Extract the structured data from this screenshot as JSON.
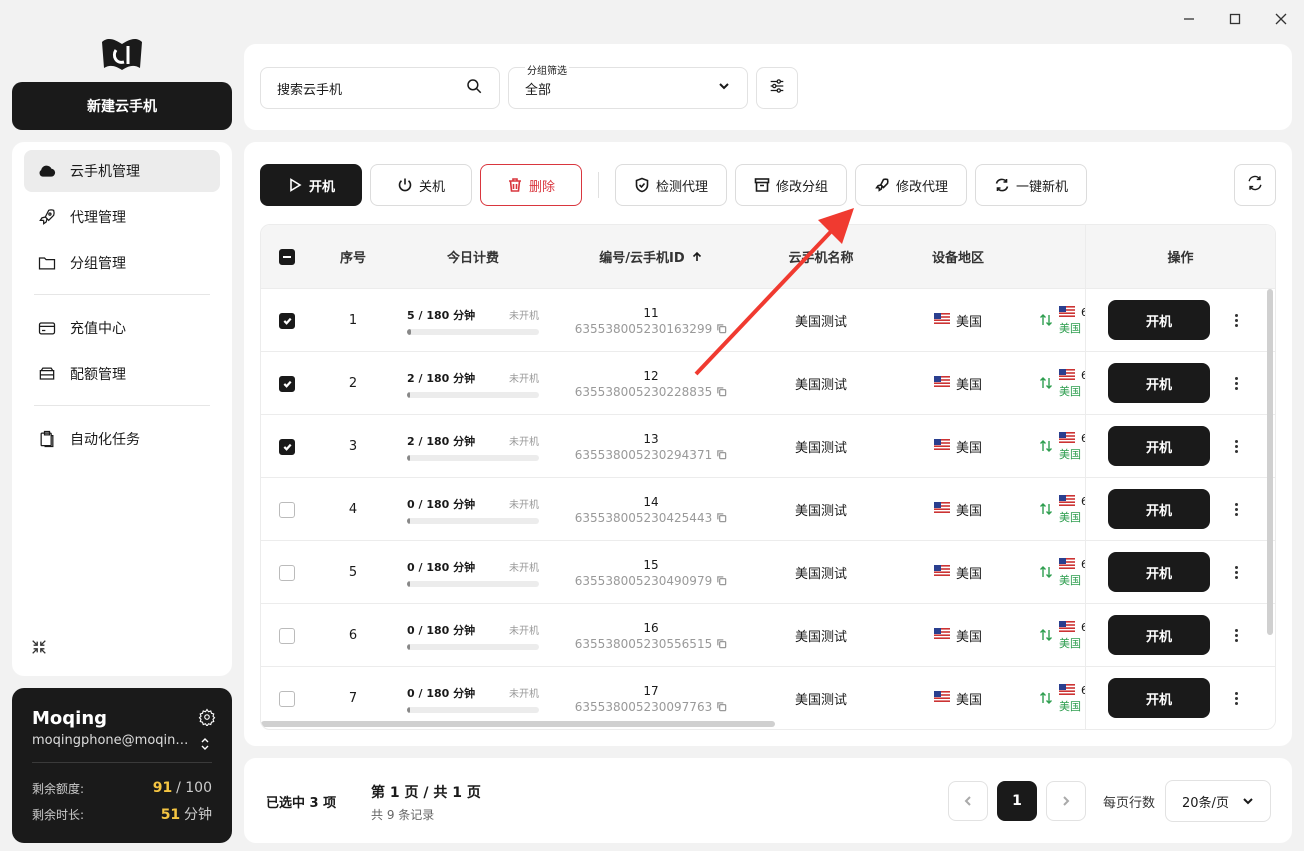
{
  "window": {
    "controls": [
      "minimize-icon",
      "maximize-icon",
      "close-icon"
    ]
  },
  "sidebar": {
    "logo": "app-logo",
    "new_button": "新建云手机",
    "items": [
      {
        "label": "云手机管理",
        "icon": "cloud-icon",
        "active": true
      },
      {
        "label": "代理管理",
        "icon": "rocket-icon"
      },
      {
        "label": "分组管理",
        "icon": "folder-icon"
      },
      {
        "label": "充值中心",
        "icon": "card-icon"
      },
      {
        "label": "配额管理",
        "icon": "storage-icon"
      },
      {
        "label": "自动化任务",
        "icon": "clipboard-icon"
      }
    ],
    "user": {
      "name": "Moqing",
      "email": "moqingphone@moqing....",
      "quota_label": "剩余额度:",
      "quota_value": "91",
      "quota_total": "/ 100",
      "time_label": "剩余时长:",
      "time_value": "51",
      "time_unit": "分钟"
    }
  },
  "search": {
    "placeholder": "搜索云手机",
    "group_label": "分组筛选",
    "group_value": "全部"
  },
  "toolbar": {
    "power_on": "开机",
    "power_off": "关机",
    "delete": "删除",
    "check_proxy": "检测代理",
    "edit_group": "修改分组",
    "edit_proxy": "修改代理",
    "one_click_new": "一键新机"
  },
  "table": {
    "headers": {
      "index": "序号",
      "fee": "今日计费",
      "id": "编号/云手机ID",
      "name": "云手机名称",
      "region": "设备地区",
      "proxy": "",
      "actions": "操作"
    },
    "rows": [
      {
        "checked": true,
        "index": "1",
        "fee": "5 / 180 分钟",
        "status": "未开机",
        "progress": 0.028,
        "num": "11",
        "cid": "635538005230163299",
        "name": "美国测试",
        "region": "美国",
        "proxy_top": "6",
        "proxy_bottom": "美国",
        "action": "开机"
      },
      {
        "checked": true,
        "index": "2",
        "fee": "2 / 180 分钟",
        "status": "未开机",
        "progress": 0.011,
        "num": "12",
        "cid": "635538005230228835",
        "name": "美国测试",
        "region": "美国",
        "proxy_top": "6",
        "proxy_bottom": "美国",
        "action": "开机"
      },
      {
        "checked": true,
        "index": "3",
        "fee": "2 / 180 分钟",
        "status": "未开机",
        "progress": 0.011,
        "num": "13",
        "cid": "635538005230294371",
        "name": "美国测试",
        "region": "美国",
        "proxy_top": "6",
        "proxy_bottom": "美国",
        "action": "开机"
      },
      {
        "checked": false,
        "index": "4",
        "fee": "0 / 180 分钟",
        "status": "未开机",
        "progress": 0,
        "num": "14",
        "cid": "635538005230425443",
        "name": "美国测试",
        "region": "美国",
        "proxy_top": "6",
        "proxy_bottom": "美国",
        "action": "开机"
      },
      {
        "checked": false,
        "index": "5",
        "fee": "0 / 180 分钟",
        "status": "未开机",
        "progress": 0,
        "num": "15",
        "cid": "635538005230490979",
        "name": "美国测试",
        "region": "美国",
        "proxy_top": "6",
        "proxy_bottom": "美国",
        "action": "开机"
      },
      {
        "checked": false,
        "index": "6",
        "fee": "0 / 180 分钟",
        "status": "未开机",
        "progress": 0,
        "num": "16",
        "cid": "635538005230556515",
        "name": "美国测试",
        "region": "美国",
        "proxy_top": "6",
        "proxy_bottom": "美国",
        "action": "开机"
      },
      {
        "checked": false,
        "index": "7",
        "fee": "0 / 180 分钟",
        "status": "未开机",
        "progress": 0,
        "num": "17",
        "cid": "635538005230097763",
        "name": "美国测试",
        "region": "美国",
        "proxy_top": "6",
        "proxy_bottom": "美国",
        "action": "开机"
      }
    ]
  },
  "footer": {
    "selected": "已选中 3 项",
    "page": "第 1 页 / 共 1 页",
    "records": "共 9 条记录",
    "current_page": "1",
    "per_page_label": "每页行数",
    "per_page_value": "20条/页"
  },
  "colors": {
    "accent": "#1a1a1a",
    "danger": "#d9363e",
    "quota": "#f5c542",
    "proxy_ok": "#2e9e4f",
    "annotation_arrow": "#f03a30"
  }
}
